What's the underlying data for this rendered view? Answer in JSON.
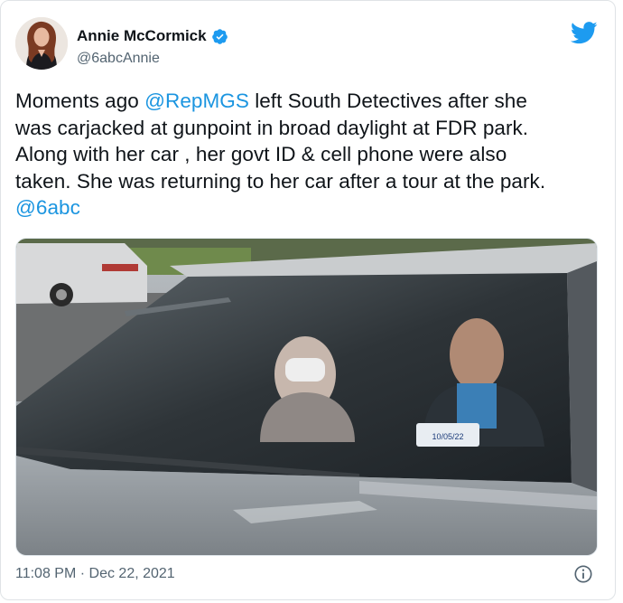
{
  "author": {
    "name": "Annie McCormick",
    "handle": "@6abcAnnie",
    "verified_icon": "verified-badge-icon",
    "avatar_icon": "profile-avatar"
  },
  "platform_icon": "twitter-bird-icon",
  "tweet": {
    "lines": [
      {
        "pre": "Moments ago ",
        "mention": "@RepMGS",
        "post": " left South Detectives after she"
      },
      {
        "pre": "was carjacked at gunpoint in broad daylight at FDR park.",
        "mention": "",
        "post": ""
      },
      {
        "pre": "Along with her car , her govt ID & cell phone were also",
        "mention": "",
        "post": ""
      },
      {
        "pre": "taken. She was returning to her car after a tour at the park.",
        "mention": "",
        "post": ""
      },
      {
        "pre": "",
        "mention": "@6abc",
        "post": ""
      }
    ]
  },
  "media": {
    "description_icon": "photo",
    "windshield_sticker": "10/05/22"
  },
  "footer": {
    "timestamp": "11:08 PM · Dec 22, 2021",
    "info_icon": "info-icon"
  },
  "colors": {
    "link": "#1b95e0",
    "twitter_blue": "#1d9bf0",
    "secondary_text": "#536471"
  }
}
